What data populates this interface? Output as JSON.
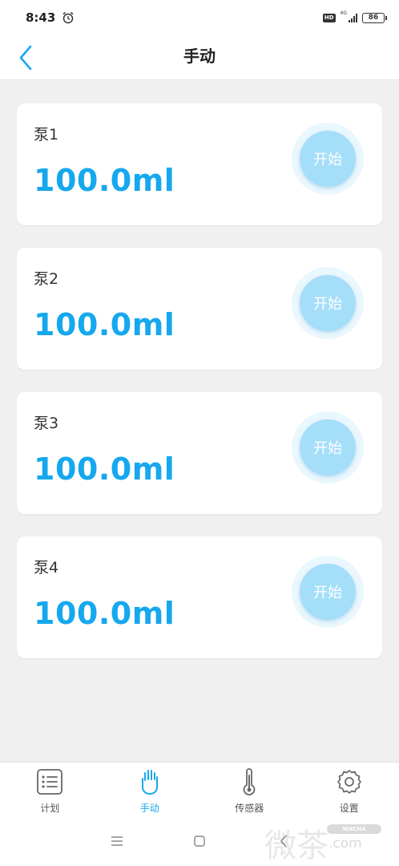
{
  "status_bar": {
    "time": "8:43",
    "network": "4G",
    "battery": "86"
  },
  "header": {
    "title": "手动"
  },
  "pumps": [
    {
      "name": "泵1",
      "volume": "100.0ml",
      "start_label": "开始"
    },
    {
      "name": "泵2",
      "volume": "100.0ml",
      "start_label": "开始"
    },
    {
      "name": "泵3",
      "volume": "100.0ml",
      "start_label": "开始"
    },
    {
      "name": "泵4",
      "volume": "100.0ml",
      "start_label": "开始"
    }
  ],
  "tabs": [
    {
      "label": "计划",
      "icon": "list-icon",
      "active": false
    },
    {
      "label": "手动",
      "icon": "hand-icon",
      "active": true
    },
    {
      "label": "传感器",
      "icon": "thermometer-icon",
      "active": false
    },
    {
      "label": "设置",
      "icon": "gear-icon",
      "active": false
    }
  ],
  "watermark": {
    "main": "微茶",
    "badge": "WXCHA",
    "sub": ".com"
  },
  "colors": {
    "accent": "#16a8ee",
    "button": "#a5def9",
    "background": "#f0f0f0"
  }
}
